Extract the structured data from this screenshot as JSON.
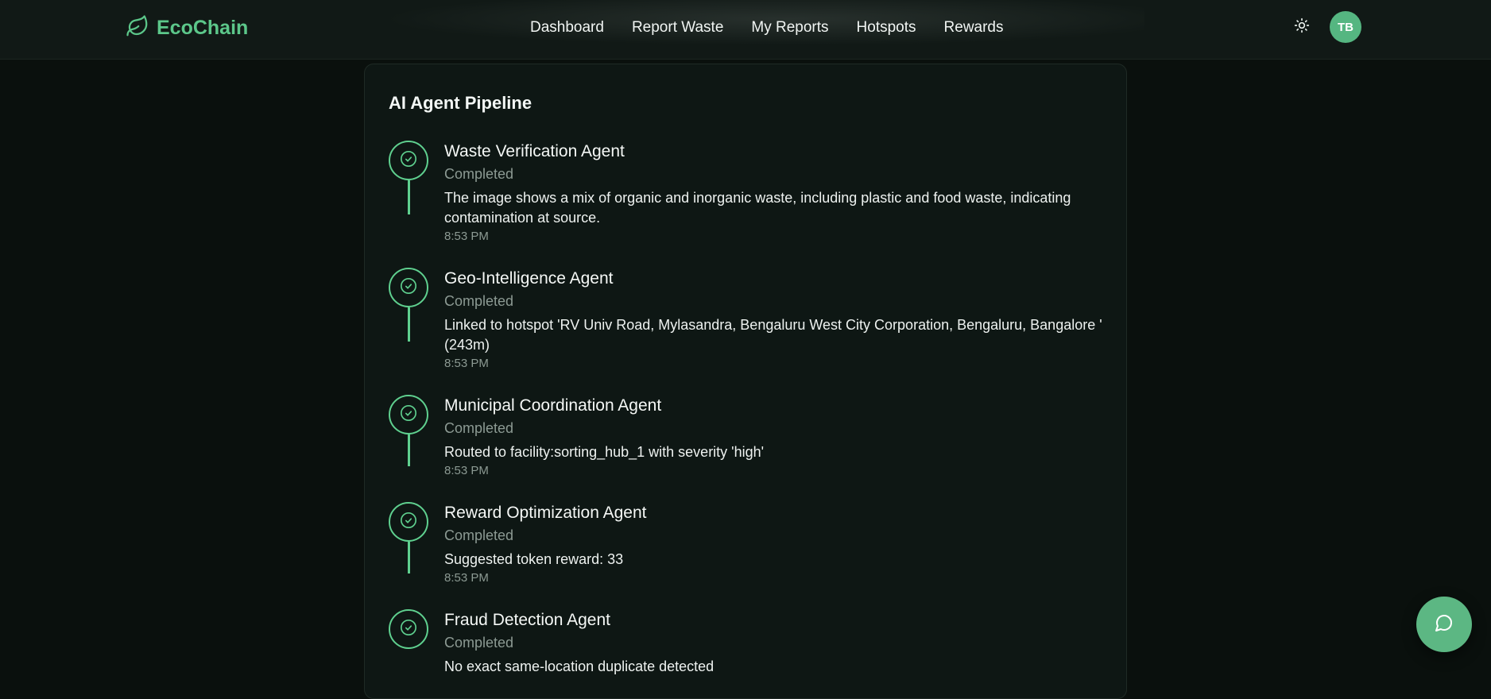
{
  "app": {
    "name": "EcoChain",
    "logo_icon": "leaf-icon",
    "accent": "#5cc78a"
  },
  "nav": {
    "links": [
      "Dashboard",
      "Report Waste",
      "My Reports",
      "Hotspots",
      "Rewards"
    ],
    "theme_icon": "sun-icon",
    "avatar_initials": "TB"
  },
  "pipeline": {
    "title": "AI Agent Pipeline",
    "steps": [
      {
        "name": "Waste Verification Agent",
        "status": "Completed",
        "description": "The image shows a mix of organic and inorganic waste, including plastic and food waste, indicating contamination at source.",
        "time": "8:53 PM"
      },
      {
        "name": "Geo-Intelligence Agent",
        "status": "Completed",
        "description": "Linked to hotspot 'RV Univ Road, Mylasandra, Bengaluru West City Corporation, Bengaluru, Bangalore ' (243m)",
        "time": "8:53 PM"
      },
      {
        "name": "Municipal Coordination Agent",
        "status": "Completed",
        "description": "Routed to facility:sorting_hub_1 with severity 'high'",
        "time": "8:53 PM"
      },
      {
        "name": "Reward Optimization Agent",
        "status": "Completed",
        "description": "Suggested token reward: 33",
        "time": "8:53 PM"
      },
      {
        "name": "Fraud Detection Agent",
        "status": "Completed",
        "description": "No exact same-location duplicate detected",
        "time": ""
      }
    ]
  },
  "chat": {
    "icon": "chat-bubble-icon"
  }
}
